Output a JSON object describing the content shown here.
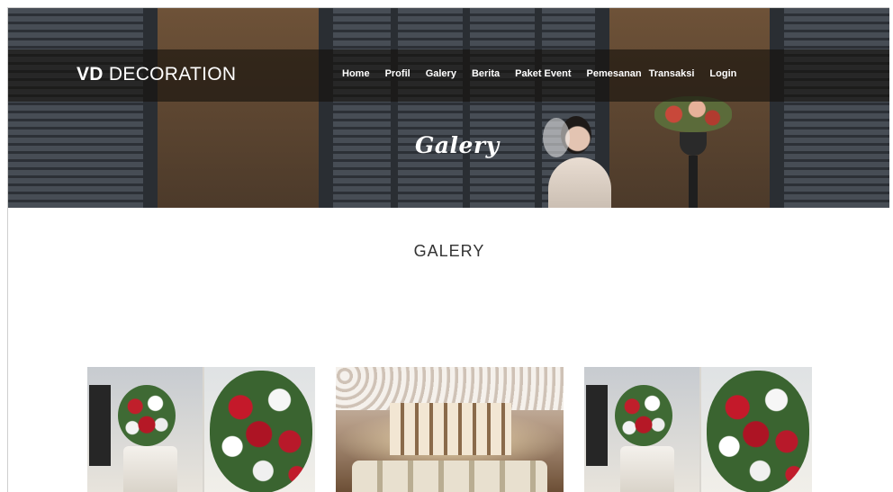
{
  "header": {
    "brand_bold": "VD",
    "brand_rest": "DECORATION",
    "nav": [
      {
        "label": "Home"
      },
      {
        "label": "Profil"
      },
      {
        "label": "Galery"
      },
      {
        "label": "Berita"
      },
      {
        "label": "Paket Event"
      },
      {
        "label": "Pemesanan"
      },
      {
        "label": "Transaksi"
      },
      {
        "label": "Login"
      }
    ]
  },
  "hero": {
    "title": "Galery"
  },
  "main": {
    "section_title": "GALERY"
  }
}
